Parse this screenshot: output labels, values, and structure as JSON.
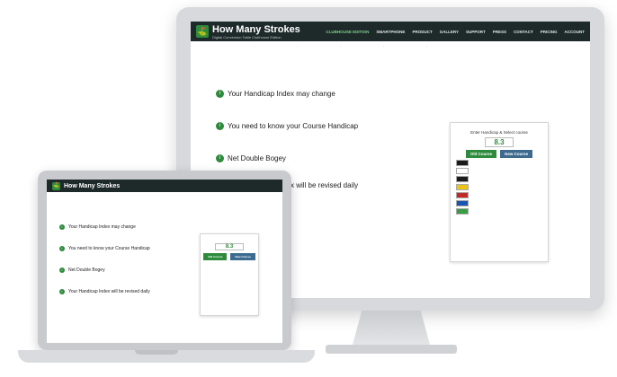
{
  "site": {
    "brand": "How Many Strokes",
    "tagline": "Digital Conversion Table Clubhouse Edition",
    "nav": [
      "CLUBHOUSE EDITION",
      "SMARTPHONE",
      "PRODUCT",
      "GALLERY",
      "SUPPORT",
      "PRESS",
      "CONTACT",
      "PRICING",
      "ACCOUNT"
    ]
  },
  "sections": [
    {
      "title": "Your Handicap Index may change"
    },
    {
      "title": "You need to know your Course Handicap"
    },
    {
      "title": "Net Double Bogey"
    },
    {
      "title": "Your Handicap Index will be revised daily"
    }
  ],
  "widget": {
    "title": "Enter Handicap & Select course",
    "value": "8.3",
    "old_course": "Old Course",
    "new_course": "New Course",
    "tees": [
      {
        "color": "#1b1b1b"
      },
      {
        "color": "#ffffff"
      },
      {
        "color": "#1b1b1b"
      },
      {
        "color": "#e8c416"
      },
      {
        "color": "#c22a2a"
      },
      {
        "color": "#1b55b3"
      },
      {
        "color": "#3a9b45"
      }
    ],
    "colors": {
      "old": "#2e8b3d",
      "new": "#3d6b8f"
    }
  }
}
